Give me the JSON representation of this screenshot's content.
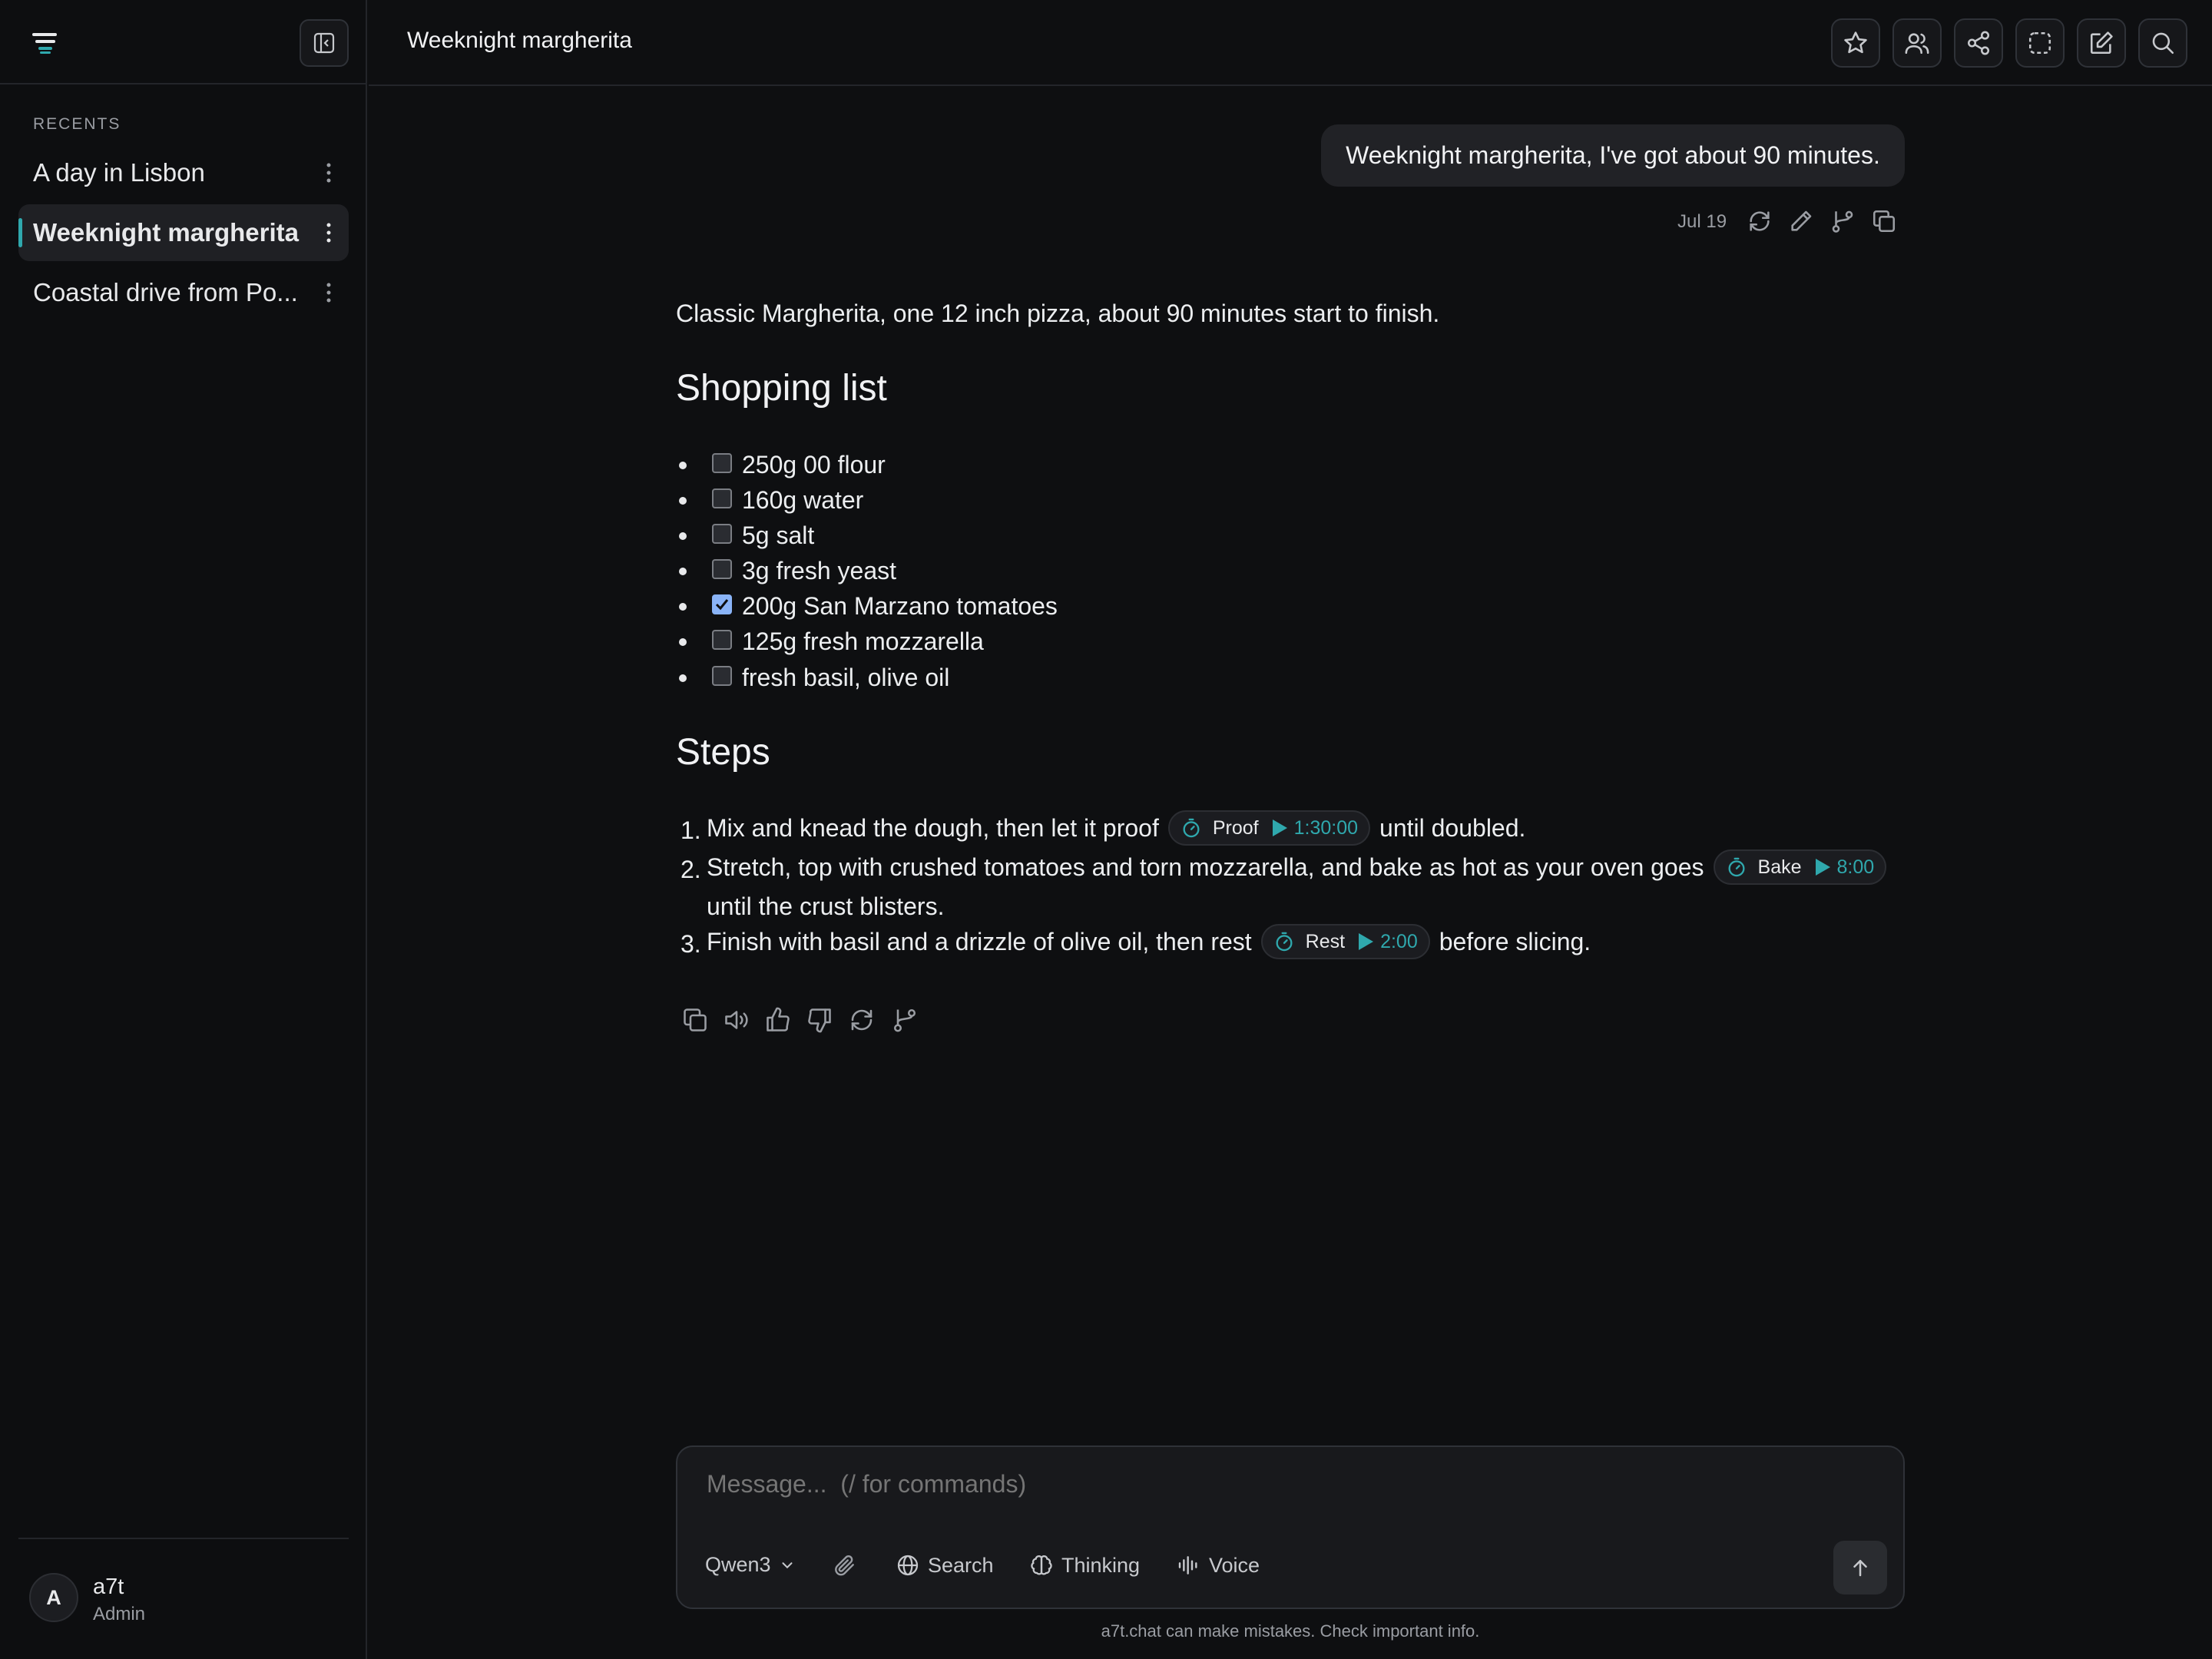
{
  "colors": {
    "accent": "#2fa8ad",
    "checkbox_checked": "#8ab4f8",
    "background": "#0e0f11"
  },
  "sidebar": {
    "recents_label": "RECENTS",
    "items": [
      {
        "label": "A day in Lisbon",
        "active": false
      },
      {
        "label": "Weeknight margherita",
        "active": true
      },
      {
        "label": "Coastal drive from Po...",
        "active": false
      }
    ],
    "user": {
      "initial": "A",
      "name": "a7t",
      "role": "Admin"
    }
  },
  "header": {
    "title": "Weeknight margherita",
    "icons": [
      "star-icon",
      "users-icon",
      "share-icon",
      "select-region-icon",
      "new-chat-icon",
      "search-icon"
    ]
  },
  "conversation": {
    "user_message": "Weeknight margherita, I've got about 90 minutes.",
    "user_message_date": "Jul 19",
    "response": {
      "intro": "Classic Margherita, one 12 inch pizza, about 90 minutes start to finish.",
      "shopping_heading": "Shopping list",
      "shopping_list": [
        {
          "text": "250g 00 flour",
          "checked": false
        },
        {
          "text": "160g water",
          "checked": false
        },
        {
          "text": "5g salt",
          "checked": false
        },
        {
          "text": "3g fresh yeast",
          "checked": false
        },
        {
          "text": "200g San Marzano tomatoes",
          "checked": true
        },
        {
          "text": "125g fresh mozzarella",
          "checked": false
        },
        {
          "text": "fresh basil, olive oil",
          "checked": false
        }
      ],
      "steps_heading": "Steps",
      "steps": [
        {
          "num": "1.",
          "before": "Mix and knead the dough, then let it proof",
          "timer_label": "Proof",
          "timer_time": "1:30:00",
          "after": "until doubled."
        },
        {
          "num": "2.",
          "before": "Stretch, top with crushed tomatoes and torn mozzarella, and bake as hot as your oven goes",
          "timer_label": "Bake",
          "timer_time": "8:00",
          "after": "",
          "continuation": "until the crust blisters."
        },
        {
          "num": "3.",
          "before": "Finish with basil and a drizzle of olive oil, then rest",
          "timer_label": "Rest",
          "timer_time": "2:00",
          "after": "before slicing."
        }
      ]
    }
  },
  "composer": {
    "placeholder": "Message...  (/ for commands)",
    "model": "Qwen3",
    "search_label": "Search",
    "thinking_label": "Thinking",
    "voice_label": "Voice"
  },
  "disclaimer": "a7t.chat can make mistakes. Check important info."
}
